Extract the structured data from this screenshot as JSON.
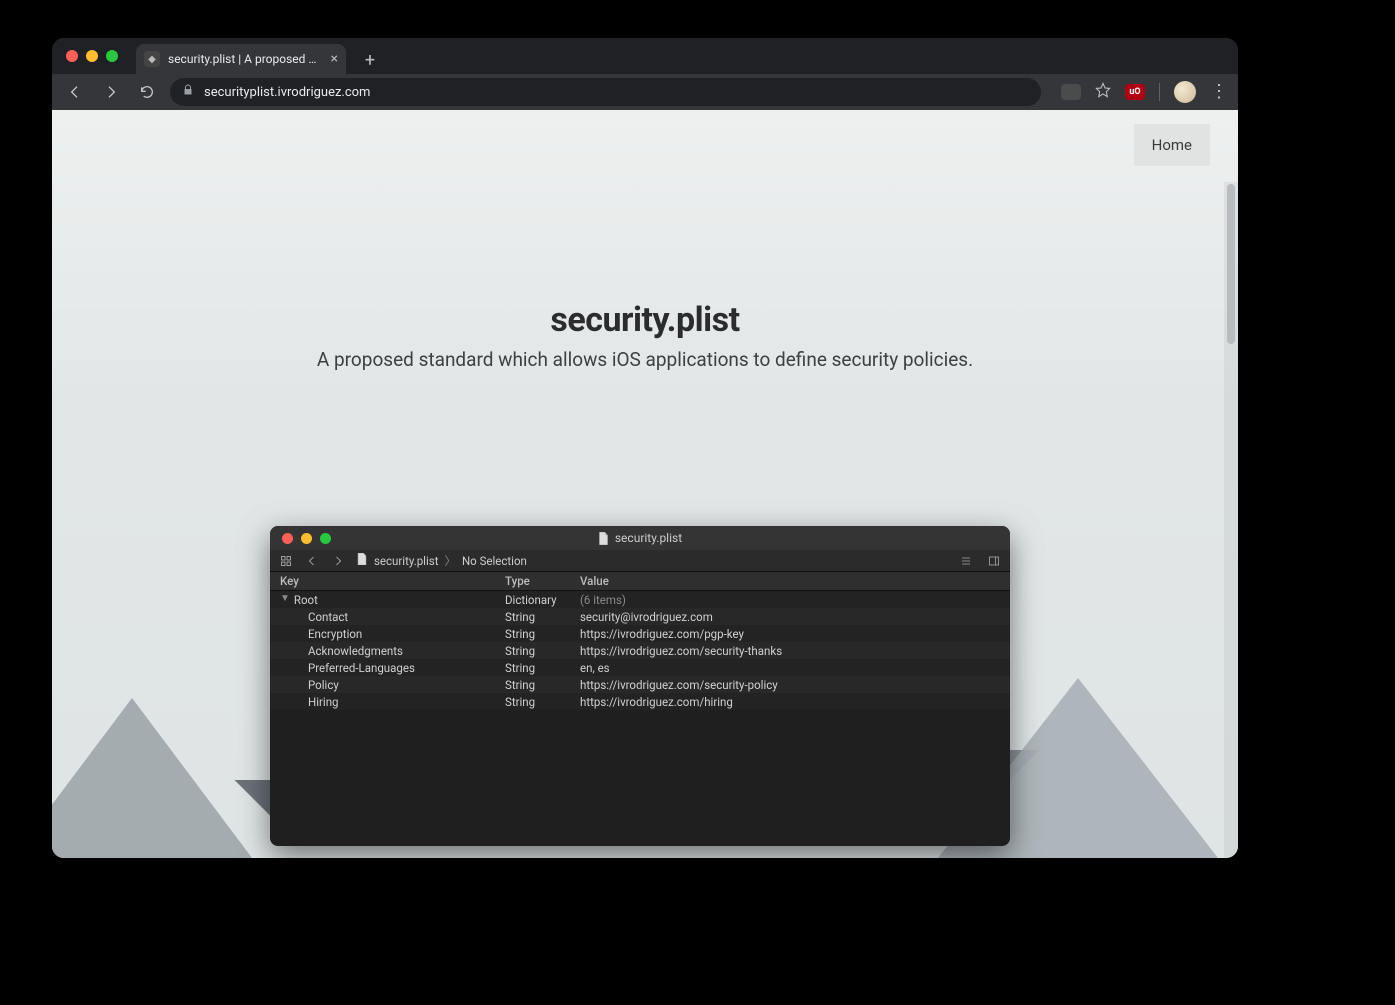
{
  "browser": {
    "tab_title": "security.plist | A proposed stan",
    "url": "securityplist.ivrodriguez.com",
    "extensions": {
      "ext1_bg": "#4b4b4b",
      "ext1_text": "",
      "ext2_bg": "#b00013",
      "ext2_text": "uO"
    }
  },
  "page": {
    "nav_home": "Home",
    "hero_title": "security.plist",
    "hero_subtitle": "A proposed standard which allows iOS applications to define security policies."
  },
  "xcode": {
    "window_title": "security.plist",
    "breadcrumb_file": "security.plist",
    "breadcrumb_trail": "No Selection",
    "columns": {
      "key": "Key",
      "type": "Type",
      "value": "Value"
    },
    "root": {
      "key": "Root",
      "type": "Dictionary",
      "value": "(6 items)"
    },
    "items": [
      {
        "key": "Contact",
        "type": "String",
        "value": "security@ivrodriguez.com"
      },
      {
        "key": "Encryption",
        "type": "String",
        "value": "https://ivrodriguez.com/pgp-key"
      },
      {
        "key": "Acknowledgments",
        "type": "String",
        "value": "https://ivrodriguez.com/security-thanks"
      },
      {
        "key": "Preferred-Languages",
        "type": "String",
        "value": "en, es"
      },
      {
        "key": "Policy",
        "type": "String",
        "value": "https://ivrodriguez.com/security-policy"
      },
      {
        "key": "Hiring",
        "type": "String",
        "value": "https://ivrodriguez.com/hiring"
      }
    ]
  }
}
